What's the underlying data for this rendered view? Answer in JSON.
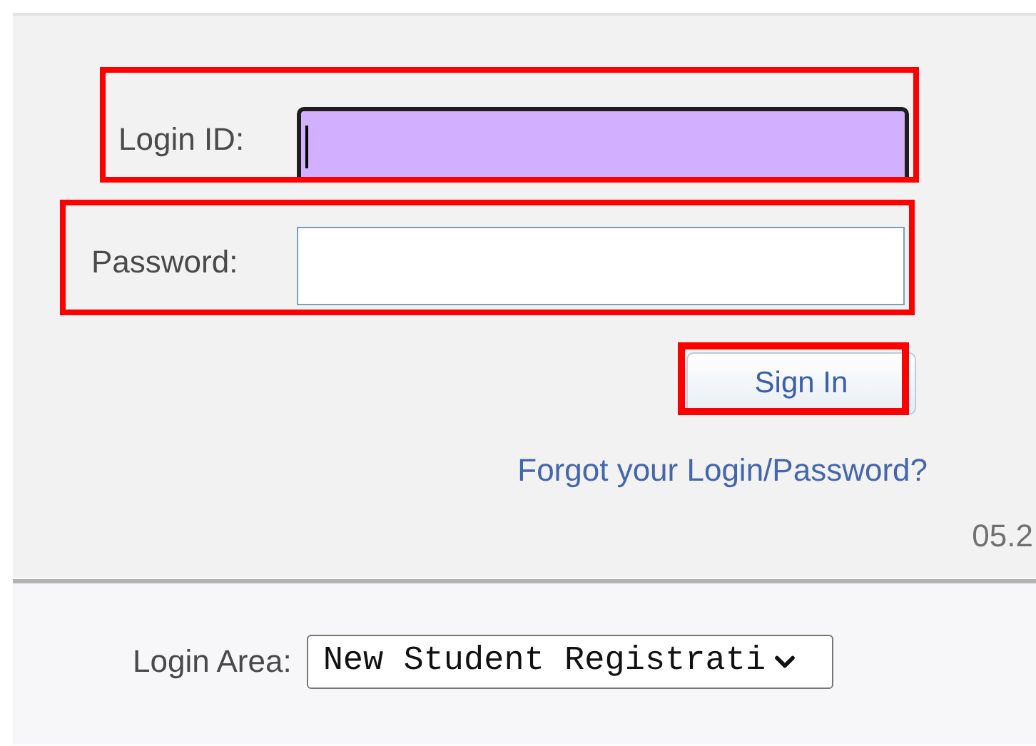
{
  "login_id": {
    "label": "Login ID:",
    "focused": true,
    "highlighted": true
  },
  "password": {
    "label": "Password:",
    "focused": false,
    "highlighted": true
  },
  "sign_in": {
    "label": "Sign In",
    "highlighted": true
  },
  "forgot_link": "Forgot your Login/Password?",
  "version": "05.2",
  "login_area": {
    "label": "Login Area:",
    "value": "New Student Registrati"
  }
}
